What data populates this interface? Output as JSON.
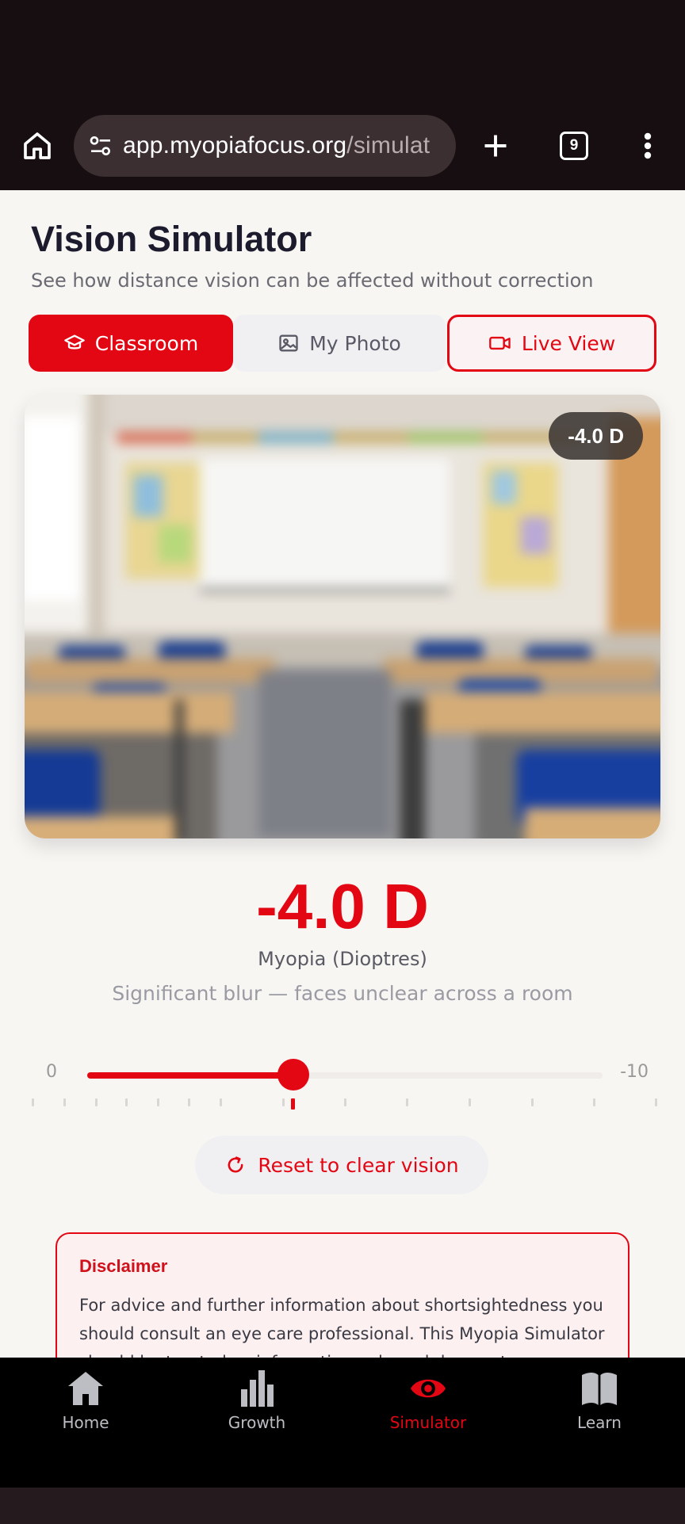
{
  "browser": {
    "url_main": "app.myopiafocus.org",
    "url_path": "/simulat",
    "tab_count": "9"
  },
  "page": {
    "title": "Vision Simulator",
    "subtitle": "See how distance vision can be affected without correction"
  },
  "modes": {
    "classroom": "Classroom",
    "photo": "My Photo",
    "live": "Live View",
    "selected": "Classroom"
  },
  "viewer": {
    "badge": "-4.0 D",
    "scene": "classroom"
  },
  "reading": {
    "value": "-4.0 D",
    "unit": "Myopia (Dioptres)",
    "description": "Significant blur — faces unclear across a room"
  },
  "slider": {
    "min_label": "0",
    "max_label": "-10",
    "value_fraction": 0.4
  },
  "reset_label": "Reset to clear vision",
  "disclaimer": {
    "title": "Disclaimer",
    "text": "For advice and further information about shortsightedness you should consult an eye care professional. This Myopia Simulator should be treated as information only and does not represent..."
  },
  "nav": {
    "items": [
      {
        "label": "Home",
        "icon": "home-icon"
      },
      {
        "label": "Growth",
        "icon": "bar-chart-icon"
      },
      {
        "label": "Simulator",
        "icon": "eye-icon"
      },
      {
        "label": "Learn",
        "icon": "book-icon"
      }
    ],
    "active": "Simulator"
  },
  "colors": {
    "accent": "#e30613",
    "background": "#f8f6f3"
  }
}
